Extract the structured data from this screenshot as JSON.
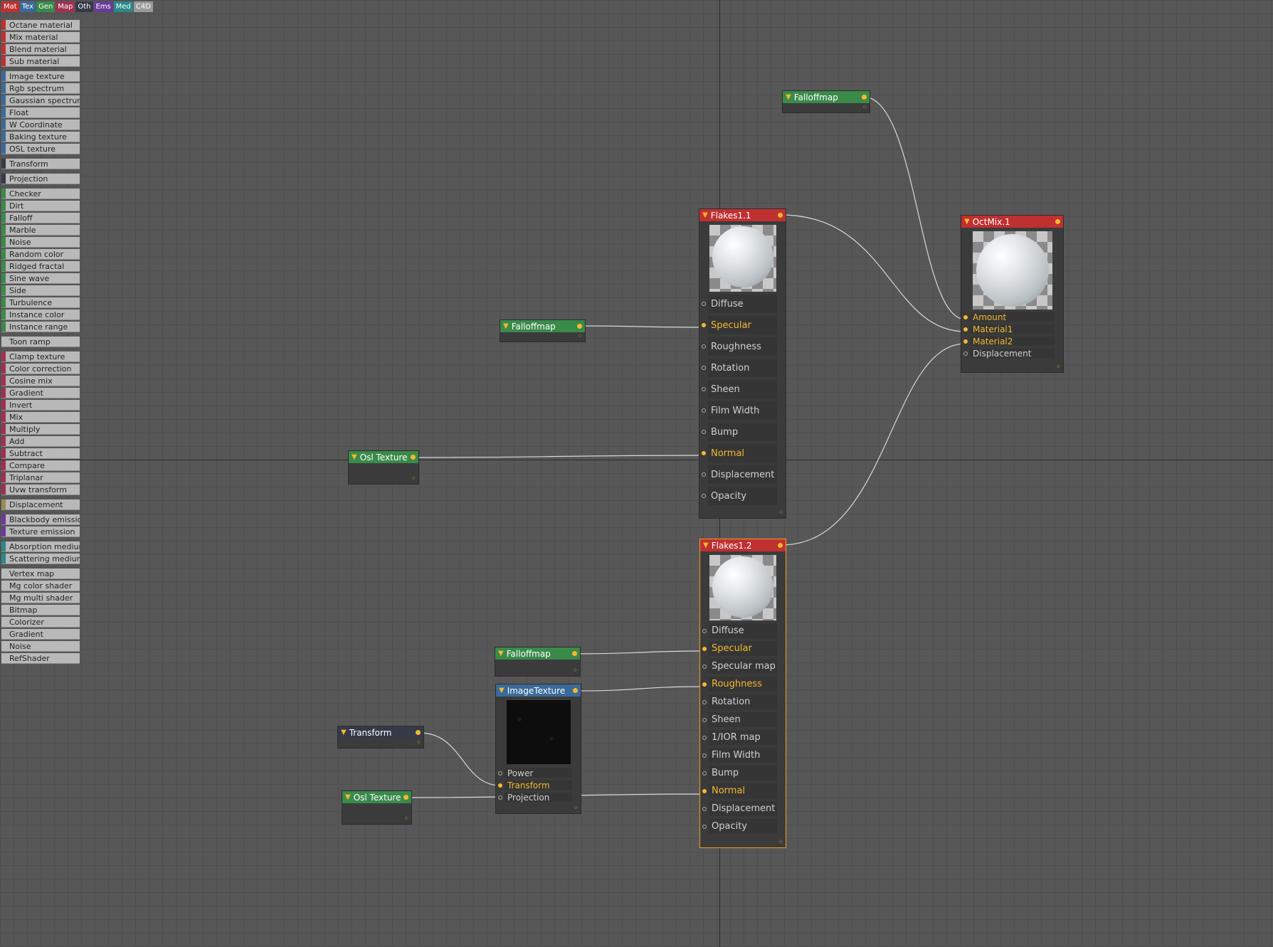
{
  "tabs": [
    {
      "label": "Mat",
      "color": "#c03030"
    },
    {
      "label": "Tex",
      "color": "#3a6a9a"
    },
    {
      "label": "Gen",
      "color": "#3a8a4a"
    },
    {
      "label": "Map",
      "color": "#a03050"
    },
    {
      "label": "Oth",
      "color": "#353a48"
    },
    {
      "label": "Ems",
      "color": "#6a3a9a"
    },
    {
      "label": "Med",
      "color": "#2a8a8a"
    },
    {
      "label": "C4D",
      "color": "#9a9a9a"
    }
  ],
  "palette": [
    {
      "label": "Octane material",
      "color": "#c03030"
    },
    {
      "label": "Mix material",
      "color": "#c03030"
    },
    {
      "label": "Blend material",
      "color": "#c03030"
    },
    {
      "label": "Sub material",
      "color": "#c03030"
    },
    {
      "label": "Image texture",
      "color": "#3a6a9a"
    },
    {
      "label": "Rgb spectrum",
      "color": "#3a6a9a"
    },
    {
      "label": "Gaussian spectrum",
      "color": "#3a6a9a"
    },
    {
      "label": "Float",
      "color": "#3a6a9a"
    },
    {
      "label": "W Coordinate",
      "color": "#3a6a9a"
    },
    {
      "label": "Baking texture",
      "color": "#3a6a9a"
    },
    {
      "label": "OSL texture",
      "color": "#3a6a9a"
    },
    {
      "label": "Transform",
      "color": "#353a48"
    },
    {
      "label": "Projection",
      "color": "#353a48"
    },
    {
      "label": "Checker",
      "color": "#3a8a4a"
    },
    {
      "label": "Dirt",
      "color": "#3a8a4a"
    },
    {
      "label": "Falloff",
      "color": "#3a8a4a"
    },
    {
      "label": "Marble",
      "color": "#3a8a4a"
    },
    {
      "label": "Noise",
      "color": "#3a8a4a"
    },
    {
      "label": "Random color",
      "color": "#3a8a4a"
    },
    {
      "label": "Ridged fractal",
      "color": "#3a8a4a"
    },
    {
      "label": "Sine wave",
      "color": "#3a8a4a"
    },
    {
      "label": "Side",
      "color": "#3a8a4a"
    },
    {
      "label": "Turbulence",
      "color": "#3a8a4a"
    },
    {
      "label": "Instance color",
      "color": "#3a8a4a"
    },
    {
      "label": "Instance range",
      "color": "#3a8a4a"
    },
    {
      "label": "Toon ramp",
      "color": "#b9b9b9"
    },
    {
      "label": "Clamp texture",
      "color": "#a03050"
    },
    {
      "label": "Color correction",
      "color": "#a03050"
    },
    {
      "label": "Cosine mix",
      "color": "#a03050"
    },
    {
      "label": "Gradient",
      "color": "#a03050"
    },
    {
      "label": "Invert",
      "color": "#a03050"
    },
    {
      "label": "Mix",
      "color": "#a03050"
    },
    {
      "label": "Multiply",
      "color": "#a03050"
    },
    {
      "label": "Add",
      "color": "#a03050"
    },
    {
      "label": "Subtract",
      "color": "#a03050"
    },
    {
      "label": "Compare",
      "color": "#a03050"
    },
    {
      "label": "Triplanar",
      "color": "#a03050"
    },
    {
      "label": "Uvw transform",
      "color": "#a03050"
    },
    {
      "label": "Displacement",
      "color": "#a08a50"
    },
    {
      "label": "Blackbody emission",
      "color": "#6a3a9a"
    },
    {
      "label": "Texture emission",
      "color": "#6a3a9a"
    },
    {
      "label": "Absorption medium",
      "color": "#2a8a8a"
    },
    {
      "label": "Scattering medium",
      "color": "#2a8a8a"
    },
    {
      "label": "Vertex map",
      "color": "#b9b9b9"
    },
    {
      "label": "Mg color shader",
      "color": "#b9b9b9"
    },
    {
      "label": "Mg multi shader",
      "color": "#b9b9b9"
    },
    {
      "label": "Bitmap",
      "color": "#b9b9b9"
    },
    {
      "label": "Colorizer",
      "color": "#b9b9b9"
    },
    {
      "label": "Gradient",
      "color": "#b9b9b9"
    },
    {
      "label": "Noise",
      "color": "#b9b9b9"
    },
    {
      "label": "RefShader",
      "color": "#b9b9b9"
    }
  ],
  "nodes": {
    "falloff_top": {
      "title": "Falloffmap",
      "color": "#3a8a4a"
    },
    "falloff_mid": {
      "title": "Falloffmap",
      "color": "#3a8a4a"
    },
    "osl_mid": {
      "title": "Osl Texture",
      "color": "#3a8a4a"
    },
    "flakes11": {
      "title": "Flakes1.1",
      "color": "#c03030",
      "ports": [
        {
          "label": "Diffuse",
          "active": false
        },
        {
          "label": "Specular",
          "active": true
        },
        {
          "label": "Roughness",
          "active": false
        },
        {
          "label": "Rotation",
          "active": false
        },
        {
          "label": "Sheen",
          "active": false
        },
        {
          "label": "Film Width",
          "active": false
        },
        {
          "label": "Bump",
          "active": false
        },
        {
          "label": "Normal",
          "active": true
        },
        {
          "label": "Displacement",
          "active": false
        },
        {
          "label": "Opacity",
          "active": false
        }
      ]
    },
    "octmix": {
      "title": "OctMix.1",
      "color": "#c03030",
      "ports": [
        {
          "label": "Amount",
          "active": true
        },
        {
          "label": "Material1",
          "active": true
        },
        {
          "label": "Material2",
          "active": true
        },
        {
          "label": "Displacement",
          "active": false
        }
      ]
    },
    "flakes12": {
      "title": "Flakes1.2",
      "color": "#c03030",
      "ports": [
        {
          "label": "Diffuse",
          "active": false
        },
        {
          "label": "Specular",
          "active": true
        },
        {
          "label": "Specular map",
          "active": false
        },
        {
          "label": "Roughness",
          "active": true
        },
        {
          "label": "Rotation",
          "active": false
        },
        {
          "label": "Sheen",
          "active": false
        },
        {
          "label": "1/IOR map",
          "active": false
        },
        {
          "label": "Film Width",
          "active": false
        },
        {
          "label": "Bump",
          "active": false
        },
        {
          "label": "Normal",
          "active": true
        },
        {
          "label": "Displacement",
          "active": false
        },
        {
          "label": "Opacity",
          "active": false
        }
      ]
    },
    "falloff_low": {
      "title": "Falloffmap",
      "color": "#3a8a4a"
    },
    "imagetex": {
      "title": "ImageTexture",
      "color": "#3a6a9a",
      "ports": [
        {
          "label": "Power",
          "active": false
        },
        {
          "label": "Transform",
          "active": true
        },
        {
          "label": "Projection",
          "active": false
        }
      ]
    },
    "transform": {
      "title": "Transform",
      "color": "#353a48"
    },
    "osl_low": {
      "title": "Osl Texture",
      "color": "#3a8a4a"
    }
  },
  "wire_color": "#d8d8d8",
  "accent": "#f5b82e"
}
